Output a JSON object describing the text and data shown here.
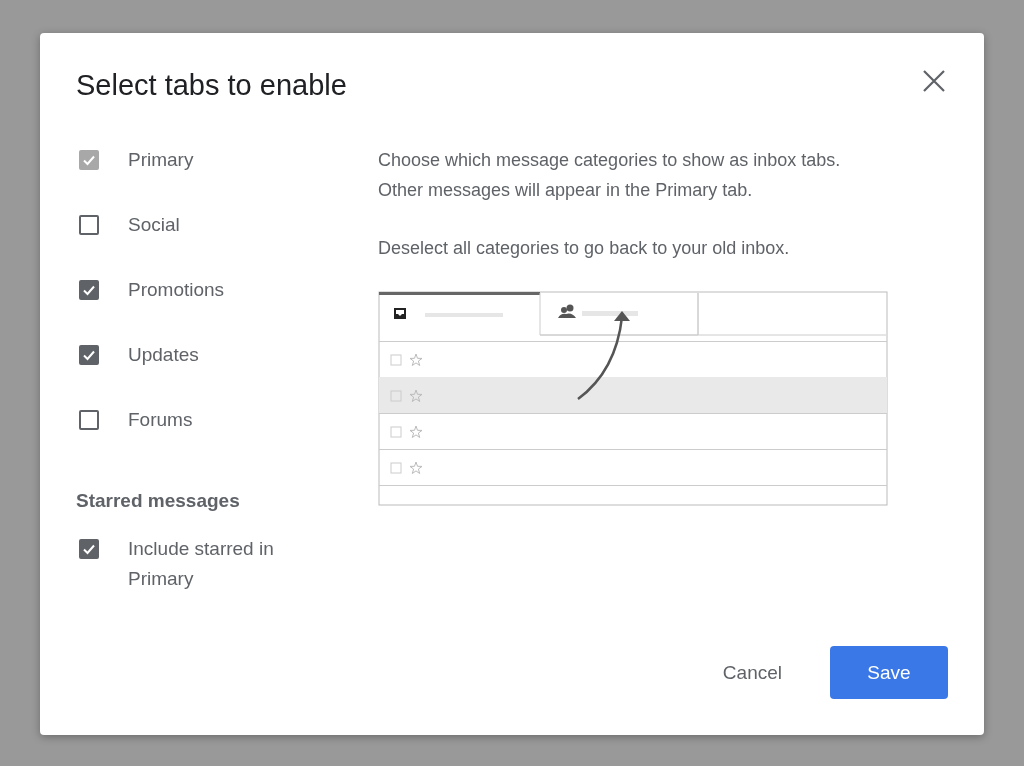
{
  "dialog": {
    "title": "Select tabs to enable",
    "categories": [
      {
        "label": "Primary",
        "checked": true,
        "disabled": true
      },
      {
        "label": "Social",
        "checked": false,
        "disabled": false
      },
      {
        "label": "Promotions",
        "checked": true,
        "disabled": false
      },
      {
        "label": "Updates",
        "checked": true,
        "disabled": false
      },
      {
        "label": "Forums",
        "checked": false,
        "disabled": false
      }
    ],
    "starred": {
      "heading": "Starred messages",
      "option": {
        "label": "Include starred in Primary",
        "checked": true,
        "disabled": false
      }
    },
    "description": [
      "Choose which message categories to show as inbox tabs. Other messages will appear in the Primary tab.",
      "Deselect all categories to go back to your old inbox."
    ],
    "buttons": {
      "cancel": "Cancel",
      "save": "Save"
    }
  }
}
